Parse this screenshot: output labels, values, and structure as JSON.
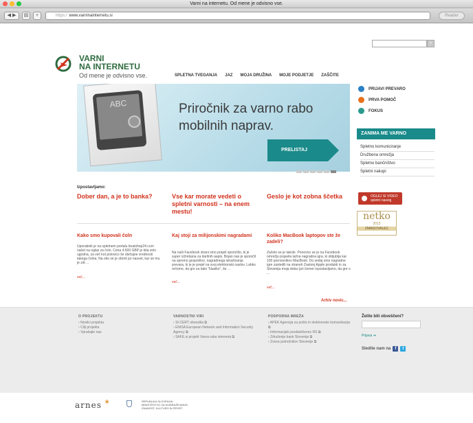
{
  "window": {
    "title": "Varni na internetu. Od mene je odvisno vse."
  },
  "toolbar": {
    "url_prefix": "https:/",
    "url": "www.varninainternetu.si",
    "reader_label": "Reader"
  },
  "logo": {
    "line1": "VARNI",
    "line2": "NA INTERNETU",
    "tagline": "Od mene je odvisno vse."
  },
  "nav": [
    "SPLETNA TVEGANJA",
    "JAZ",
    "MOJA DRUŽINA",
    "MOJE PODJETJE",
    "ZAŠČITE"
  ],
  "hero": {
    "text": "Priročnik za varno rabo mobilnih naprav.",
    "button": "PRELISTAJ",
    "slides": 6,
    "active_slide": 6
  },
  "side": {
    "links": [
      {
        "label": "PRIJAVI PREVARO",
        "color": "#2b7fc4"
      },
      {
        "label": "PRVA POMOČ",
        "color": "#e8711c"
      },
      {
        "label": "FOKUS",
        "color": "#2a9a8e"
      }
    ],
    "interest_title": "ZANIMA ME VARNO",
    "interest_items": [
      "Spletno komuniciranje",
      "Družbena omrežja",
      "Spletno bančništvo",
      "Spletni nakupi"
    ],
    "video_label_1": "OGLEJ SI VIDEO",
    "video_label_2": "spletni nasvig",
    "netko_name": "netko",
    "netko_year": "2013",
    "netko_badge": "ZMAGOVALEC"
  },
  "izpostavljamo": "Izpostavljamo:",
  "featured": [
    "Dober dan, a je to banka?",
    "Vse kar morate vedeti o spletni varnosti – na enem mestu!",
    "Geslo je kot zobna ščetka"
  ],
  "articles": [
    {
      "title": "Kako smo kupovali čoln",
      "body": "Uporabnik je na spletnem portalu boatshop24.com našel na oglas za čoln. Cena 4.500 GBP je bila zelo ugodna, za več kot polovico še običajne vrednosti takega čolna. Na oko se je obrnil po nasvet, kar se mu je zdi ...",
      "more": "več..."
    },
    {
      "title": "Kaj stoji za milijonskimi nagradami",
      "body": "Na naši Facebook strani smo prejeli sporočilo, ki je super izžrebana za darilnih aapls. Bojan nas je sporočil na spremo gospoštvo, nagradnega istraživanja prevara, ki je je prejel na svoj elektronski naslov. Lahko rečemo, da gre za tako \"klasiko\", še ...",
      "more": "več..."
    },
    {
      "title": "Koliko MacBook laptopov ste že zadeli?",
      "body": "Začelo se je takole. Ponovno se je na Facebook omrežju pojavila lažna nagradna igra, ki obljublja kar 100 prenosnikov MacBook. Do sedaj smo nagradne igre zasledili na straneh Zastonj Apple produkti in za Slovenija moja doba (pri čemer izpostavljamo, da gre o ...",
      "more": "več..."
    }
  ],
  "archive": "Arhiv novic...",
  "footer": {
    "cols": [
      {
        "head": "O PROJEKTU",
        "items": [
          "Nosilci projekta",
          "Cilji projekta",
          "Vprašajte nas"
        ]
      },
      {
        "head": "VARNOSTNI VIRI",
        "items": [
          "SI-CERT obvestila",
          "ENISA European Network and Information Security Agency",
          "SAFE.si projekt Varna raba interneta"
        ]
      },
      {
        "head": "PODPORNA MREŽA",
        "items": [
          "APEK Agencija za pošto in elektronske komunikacije",
          "Informacijski pooblaščenec RS",
          "Združenje bank Slovenije",
          "Zveza potrošnikov Slovenije"
        ]
      }
    ],
    "newsletter_title": "Želite biti obveščeni?",
    "signup": "Prijava",
    "follow": "Sledite nam na"
  },
  "partners": {
    "arnes": "arnes",
    "ministry_1": "REPUBLIKA SLOVENIJA",
    "ministry_2": "MINISTRSTVO ZA IZOBRAŽEVANJE, ZNANOST, KULTURO IN ŠPORT"
  },
  "colors": {
    "brand_green": "#2e6b3f",
    "accent_red": "#d1321d",
    "teal": "#1a8a8a"
  }
}
